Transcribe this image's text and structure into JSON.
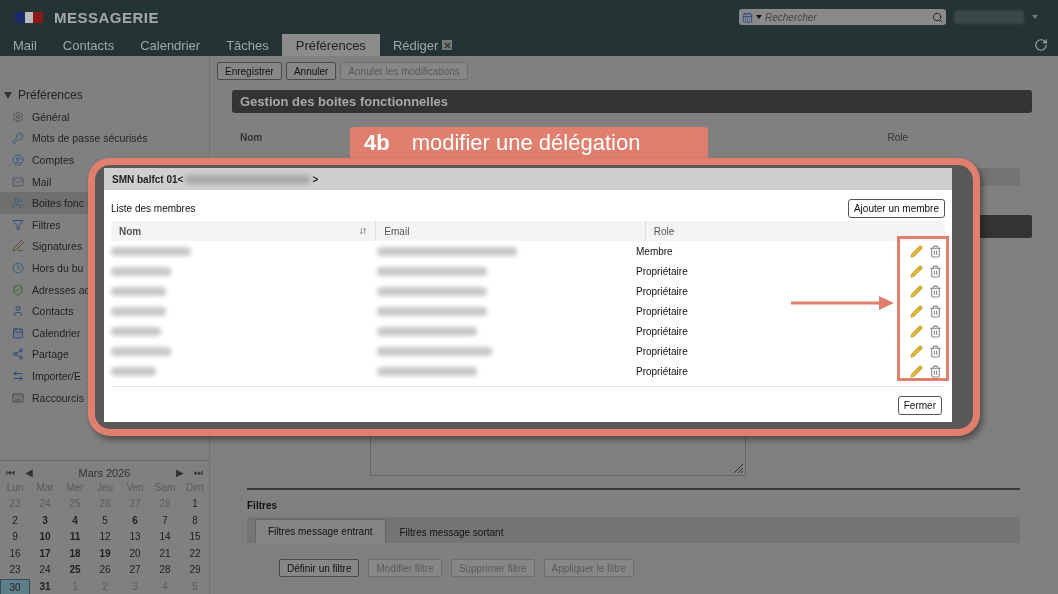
{
  "header": {
    "app_title": "MESSAGERIE",
    "search": {
      "placeholder": "Rechercher"
    }
  },
  "nav_tabs": [
    {
      "label": "Mail",
      "selected": false,
      "closable": false
    },
    {
      "label": "Contacts",
      "selected": false,
      "closable": false
    },
    {
      "label": "Calendrier",
      "selected": false,
      "closable": false
    },
    {
      "label": "Tâches",
      "selected": false,
      "closable": false
    },
    {
      "label": "Préférences",
      "selected": true,
      "closable": false
    },
    {
      "label": "Rédiger",
      "selected": false,
      "closable": true
    }
  ],
  "toolbar": [
    {
      "label": "Enregistrer",
      "disabled": false
    },
    {
      "label": "Annuler",
      "disabled": false
    },
    {
      "label": "Annuler les modifications",
      "disabled": true
    }
  ],
  "sidebar": {
    "title": "Préférences",
    "expanded": true,
    "items": [
      {
        "label": "Général",
        "selected": false
      },
      {
        "label": "Mots de passe sécurisés",
        "selected": false
      },
      {
        "label": "Comptes",
        "selected": false
      },
      {
        "label": "Mail",
        "selected": false
      },
      {
        "label": "Boites fonc",
        "selected": true
      },
      {
        "label": "Filtres",
        "selected": false
      },
      {
        "label": "Signatures",
        "selected": false
      },
      {
        "label": "Hors du bu",
        "selected": false
      },
      {
        "label": "Adresses ac",
        "selected": false
      },
      {
        "label": "Contacts",
        "selected": false
      },
      {
        "label": "Calendrier",
        "selected": false
      },
      {
        "label": "Partage",
        "selected": false
      },
      {
        "label": "Importer/E",
        "selected": false
      },
      {
        "label": "Raccourcis",
        "selected": false
      }
    ]
  },
  "calendar": {
    "month": "Mars 2026",
    "nav": [
      "⏮",
      "◀",
      "▶",
      "⏭"
    ],
    "weekdays": [
      "Lun",
      "Mar",
      "Mer",
      "Jeu",
      "Ven",
      "Sam",
      "Dim"
    ],
    "weeks": [
      [
        {
          "day": "23",
          "outside": true,
          "bold": false,
          "selected": false
        },
        {
          "day": "24",
          "outside": true,
          "bold": false,
          "selected": false
        },
        {
          "day": "25",
          "outside": true,
          "bold": false,
          "selected": false
        },
        {
          "day": "26",
          "outside": true,
          "bold": false,
          "selected": false
        },
        {
          "day": "27",
          "outside": true,
          "bold": false,
          "selected": false
        },
        {
          "day": "28",
          "outside": true,
          "bold": false,
          "selected": false
        },
        {
          "day": "1",
          "outside": false,
          "bold": false,
          "selected": false
        }
      ],
      [
        {
          "day": "2",
          "outside": false,
          "bold": false,
          "selected": false
        },
        {
          "day": "3",
          "outside": false,
          "bold": true,
          "selected": false
        },
        {
          "day": "4",
          "outside": false,
          "bold": true,
          "selected": false
        },
        {
          "day": "5",
          "outside": false,
          "bold": false,
          "selected": false
        },
        {
          "day": "6",
          "outside": false,
          "bold": true,
          "selected": false
        },
        {
          "day": "7",
          "outside": false,
          "bold": false,
          "selected": false
        },
        {
          "day": "8",
          "outside": false,
          "bold": false,
          "selected": false
        }
      ],
      [
        {
          "day": "9",
          "outside": false,
          "bold": false,
          "selected": false
        },
        {
          "day": "10",
          "outside": false,
          "bold": true,
          "selected": false
        },
        {
          "day": "11",
          "outside": false,
          "bold": true,
          "selected": false
        },
        {
          "day": "12",
          "outside": false,
          "bold": false,
          "selected": false
        },
        {
          "day": "13",
          "outside": false,
          "bold": false,
          "selected": false
        },
        {
          "day": "14",
          "outside": false,
          "bold": false,
          "selected": false
        },
        {
          "day": "15",
          "outside": false,
          "bold": false,
          "selected": false
        }
      ],
      [
        {
          "day": "16",
          "outside": false,
          "bold": false,
          "selected": false
        },
        {
          "day": "17",
          "outside": false,
          "bold": true,
          "selected": false
        },
        {
          "day": "18",
          "outside": false,
          "bold": true,
          "selected": false
        },
        {
          "day": "19",
          "outside": false,
          "bold": true,
          "selected": false
        },
        {
          "day": "20",
          "outside": false,
          "bold": false,
          "selected": false
        },
        {
          "day": "21",
          "outside": false,
          "bold": false,
          "selected": false
        },
        {
          "day": "22",
          "outside": false,
          "bold": false,
          "selected": false
        }
      ],
      [
        {
          "day": "23",
          "outside": false,
          "bold": false,
          "selected": false
        },
        {
          "day": "24",
          "outside": false,
          "bold": false,
          "selected": false
        },
        {
          "day": "25",
          "outside": false,
          "bold": true,
          "selected": false
        },
        {
          "day": "26",
          "outside": false,
          "bold": false,
          "selected": false
        },
        {
          "day": "27",
          "outside": false,
          "bold": false,
          "selected": false
        },
        {
          "day": "28",
          "outside": false,
          "bold": false,
          "selected": false
        },
        {
          "day": "29",
          "outside": false,
          "bold": false,
          "selected": false
        }
      ],
      [
        {
          "day": "30",
          "outside": false,
          "bold": false,
          "selected": true
        },
        {
          "day": "31",
          "outside": false,
          "bold": true,
          "selected": false
        },
        {
          "day": "1",
          "outside": true,
          "bold": false,
          "selected": false
        },
        {
          "day": "2",
          "outside": true,
          "bold": false,
          "selected": false
        },
        {
          "day": "3",
          "outside": true,
          "bold": false,
          "selected": false
        },
        {
          "day": "4",
          "outside": true,
          "bold": false,
          "selected": false
        },
        {
          "day": "5",
          "outside": true,
          "bold": false,
          "selected": false
        }
      ]
    ]
  },
  "main": {
    "section_title": "Gestion des boites fonctionnelles",
    "columns": [
      "Nom",
      "Role"
    ]
  },
  "filters": {
    "title": "Filtres",
    "tabs": [
      {
        "label": "Filtres message entrant",
        "selected": true
      },
      {
        "label": "Filtres message sortant",
        "selected": false
      }
    ],
    "buttons": [
      {
        "label": "Définir un filtre",
        "disabled": false
      },
      {
        "label": "Modifier filtre",
        "disabled": true
      },
      {
        "label": "Supprimer filtre",
        "disabled": true
      },
      {
        "label": "Appliquer le filtre",
        "disabled": true
      }
    ]
  },
  "dialog": {
    "title": "SMN balfct 01<",
    "title_end": ">",
    "list_label": "Liste des membres",
    "add_button": "Ajouter un membre",
    "columns": [
      "Nom",
      "Email",
      "Role"
    ],
    "rows": [
      {
        "role": "Membre"
      },
      {
        "role": "Propriétaire"
      },
      {
        "role": "Propriétaire"
      },
      {
        "role": "Propriétaire"
      },
      {
        "role": "Propriétaire"
      },
      {
        "role": "Propriétaire"
      },
      {
        "role": "Propriétaire"
      }
    ],
    "close_button": "Fermer"
  },
  "annotation": {
    "step": "4b",
    "text": "modifier une délégation"
  }
}
